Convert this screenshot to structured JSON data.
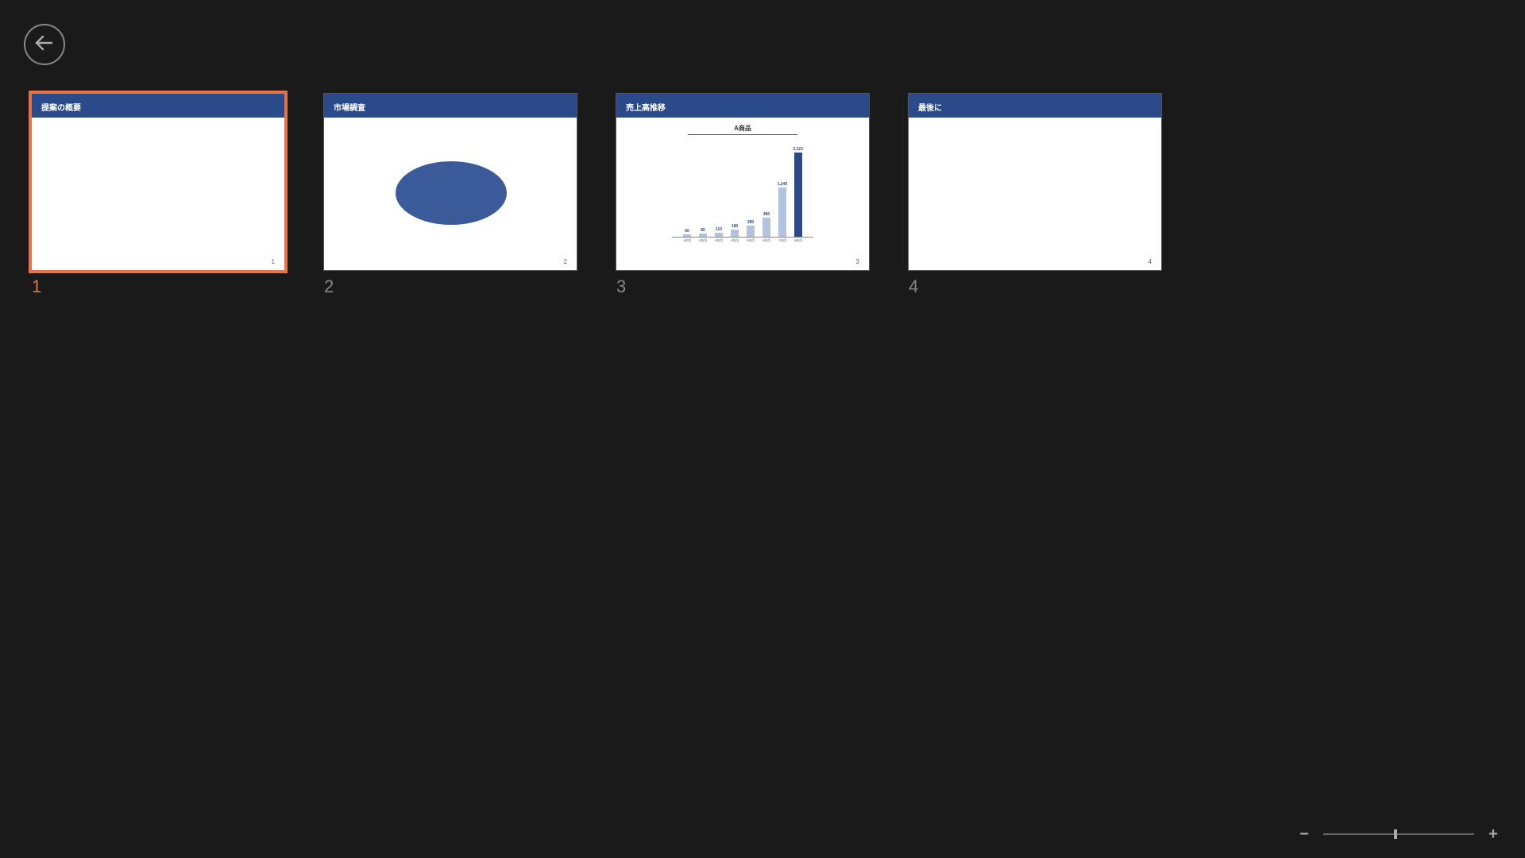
{
  "slides": [
    {
      "title": "提案の概要",
      "page": "1",
      "number": "1",
      "selected": true,
      "content": "blank"
    },
    {
      "title": "市場調査",
      "page": "2",
      "number": "2",
      "selected": false,
      "content": "ellipse"
    },
    {
      "title": "売上高推移",
      "page": "3",
      "number": "3",
      "selected": false,
      "content": "chart"
    },
    {
      "title": "最後に",
      "page": "4",
      "number": "4",
      "selected": false,
      "content": "blank"
    }
  ],
  "chart_data": {
    "type": "bar",
    "title": "A商品",
    "categories": [
      "1年目",
      "2年目",
      "3年目",
      "4年目",
      "5年目",
      "6年目",
      "7年目",
      "8年目"
    ],
    "values": [
      60,
      85,
      110,
      180,
      280,
      480,
      1240,
      2121
    ],
    "highlight_index": 7,
    "ylim": [
      0,
      2200
    ]
  },
  "zoom": {
    "minus": "−",
    "plus": "+",
    "position_pct": 47
  }
}
